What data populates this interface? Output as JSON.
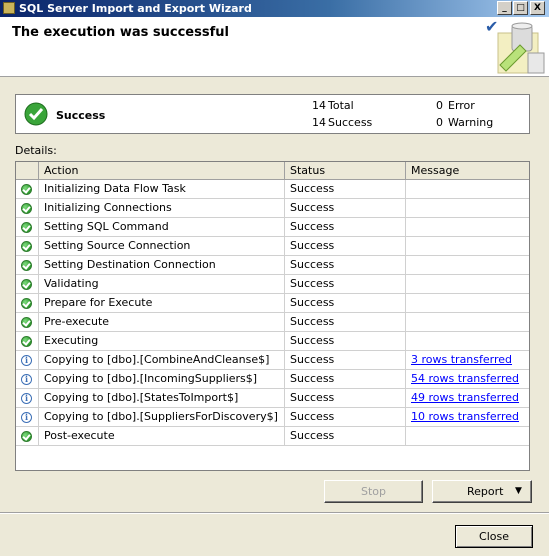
{
  "window": {
    "title": "SQL Server Import and Export Wizard",
    "controls": [
      "_",
      "□",
      "X"
    ]
  },
  "header": {
    "heading": "The execution was successful"
  },
  "summary": {
    "status": "Success",
    "total_count": "14",
    "total_label": "Total",
    "success_count": "14",
    "success_label": "Success",
    "error_count": "0",
    "error_label": "Error",
    "warning_count": "0",
    "warning_label": "Warning"
  },
  "details": {
    "label": "Details:",
    "columns": [
      "Action",
      "Status",
      "Message"
    ],
    "rows": [
      {
        "icon": "success-icon",
        "action": "Initializing Data Flow Task",
        "status": "Success",
        "message": ""
      },
      {
        "icon": "success-icon",
        "action": "Initializing Connections",
        "status": "Success",
        "message": ""
      },
      {
        "icon": "success-icon",
        "action": "Setting SQL Command",
        "status": "Success",
        "message": ""
      },
      {
        "icon": "success-icon",
        "action": "Setting Source Connection",
        "status": "Success",
        "message": ""
      },
      {
        "icon": "success-icon",
        "action": "Setting Destination Connection",
        "status": "Success",
        "message": ""
      },
      {
        "icon": "success-icon",
        "action": "Validating",
        "status": "Success",
        "message": ""
      },
      {
        "icon": "success-icon",
        "action": "Prepare for Execute",
        "status": "Success",
        "message": ""
      },
      {
        "icon": "success-icon",
        "action": "Pre-execute",
        "status": "Success",
        "message": ""
      },
      {
        "icon": "success-icon",
        "action": "Executing",
        "status": "Success",
        "message": ""
      },
      {
        "icon": "info-icon",
        "action": "Copying to [dbo].[CombineAndCleanse$]",
        "status": "Success",
        "message": "3 rows transferred"
      },
      {
        "icon": "info-icon",
        "action": "Copying to [dbo].[IncomingSuppliers$]",
        "status": "Success",
        "message": "54 rows transferred"
      },
      {
        "icon": "info-icon",
        "action": "Copying to [dbo].[StatesToImport$]",
        "status": "Success",
        "message": "49 rows transferred"
      },
      {
        "icon": "info-icon",
        "action": "Copying to [dbo].[SuppliersForDiscovery$]",
        "status": "Success",
        "message": "10 rows transferred"
      },
      {
        "icon": "success-icon",
        "action": "Post-execute",
        "status": "Success",
        "message": ""
      }
    ]
  },
  "buttons": {
    "stop": "Stop",
    "report": "Report",
    "close": "Close"
  },
  "colors": {
    "titlebar_start": "#0a246a",
    "link": "#0000ff",
    "success_green": "#2d9a2d"
  }
}
